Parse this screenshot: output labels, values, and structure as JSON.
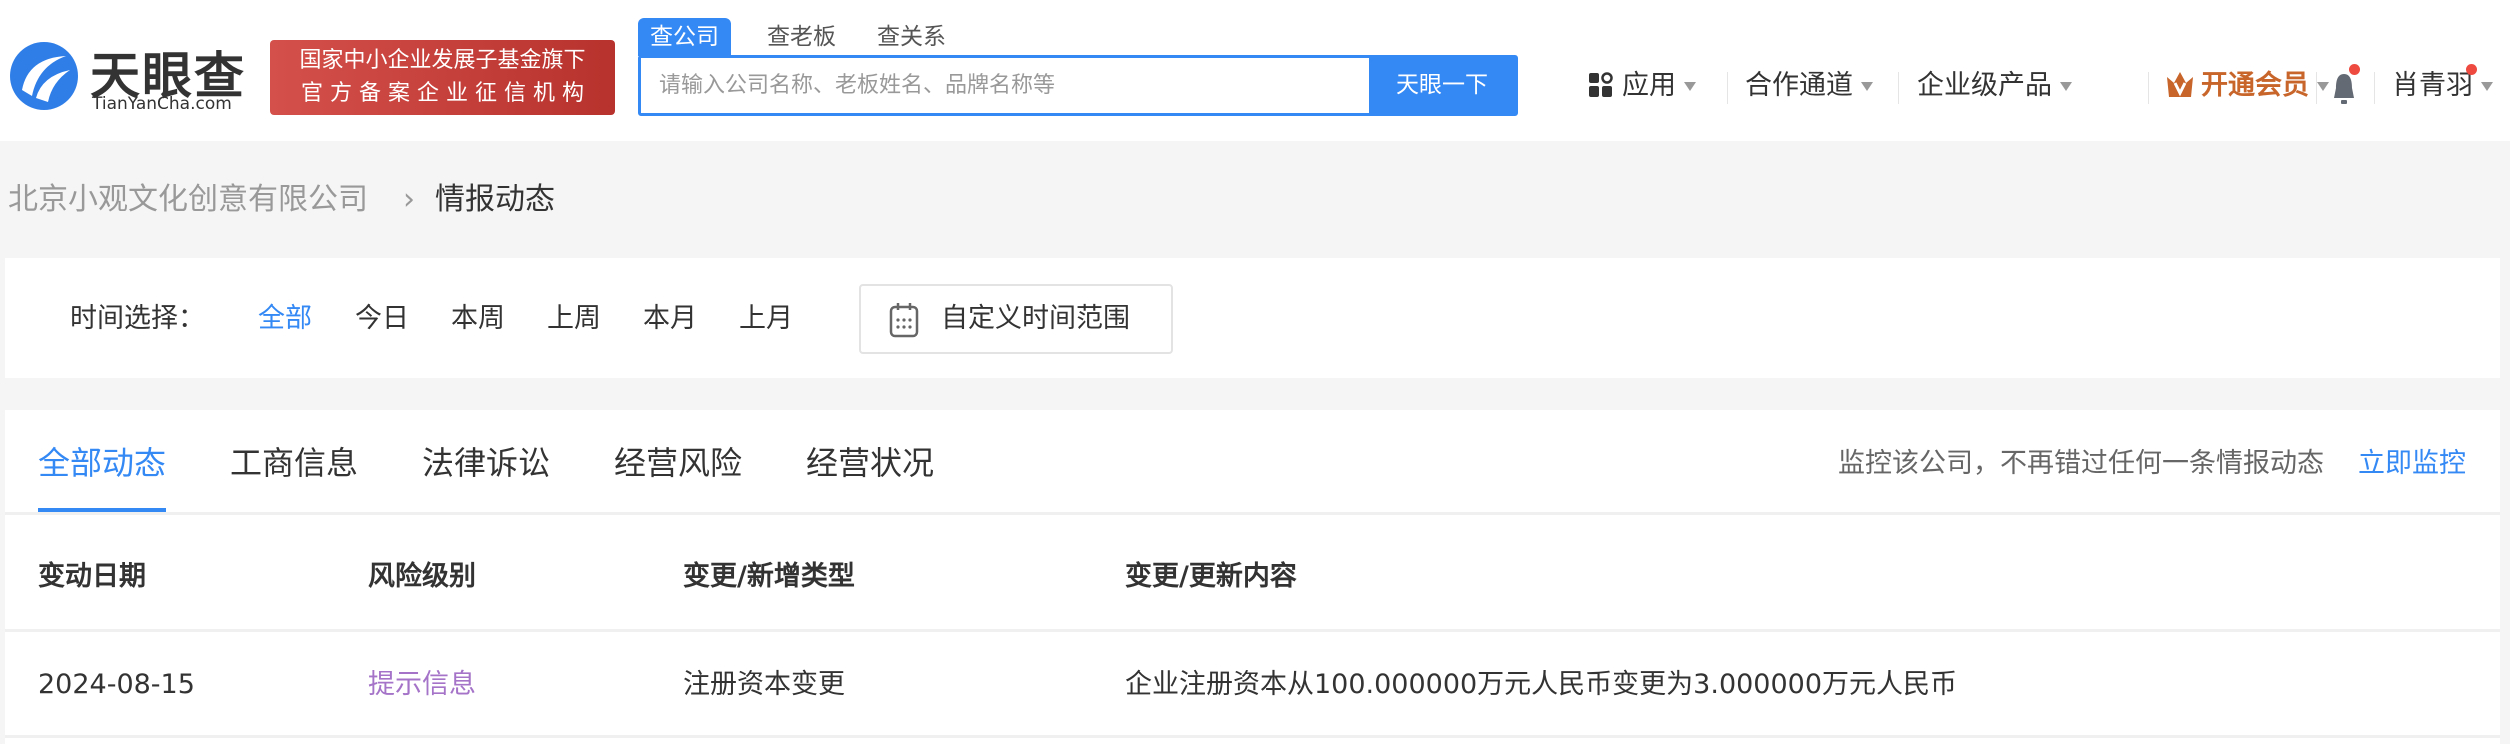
{
  "header": {
    "logo_text": "天眼查",
    "logo_sub": "TianYanCha.com",
    "badge_line1": "国家中小企业发展子基金旗下",
    "badge_line2": "官 方 备 案 企 业 征 信 机 构",
    "search_tabs": [
      "查公司",
      "查老板",
      "查关系"
    ],
    "search_placeholder": "请输入公司名称、老板姓名、品牌名称等",
    "search_button": "天眼一下",
    "nav": {
      "apps": "应用",
      "partner": "合作通道",
      "enterprise": "企业级产品",
      "vip": "开通会员",
      "user": "肖青羽"
    }
  },
  "breadcrumb": {
    "company": "北京小观文化创意有限公司",
    "separator": "›",
    "current": "情报动态"
  },
  "filter": {
    "label": "时间选择：",
    "options": [
      "全部",
      "今日",
      "本周",
      "上周",
      "本月",
      "上月"
    ],
    "custom_range": "自定义时间范围"
  },
  "tabs": [
    "全部动态",
    "工商信息",
    "法律诉讼",
    "经营风险",
    "经营状况"
  ],
  "monitor": {
    "text": "监控该公司，不再错过任何一条情报动态",
    "link": "立即监控"
  },
  "table": {
    "columns": [
      "变动日期",
      "风险级别",
      "变更/新增类型",
      "变更/更新内容"
    ],
    "rows": [
      {
        "date": "2024-08-15",
        "risk": "提示信息",
        "type": "注册资本变更",
        "content": "企业注册资本从100.000000万元人民币变更为3.000000万元人民币"
      }
    ]
  },
  "colors": {
    "accent": "#3489f5",
    "vip": "#c8652a",
    "risk_info": "#a574c9",
    "badge": "#c8403a"
  }
}
